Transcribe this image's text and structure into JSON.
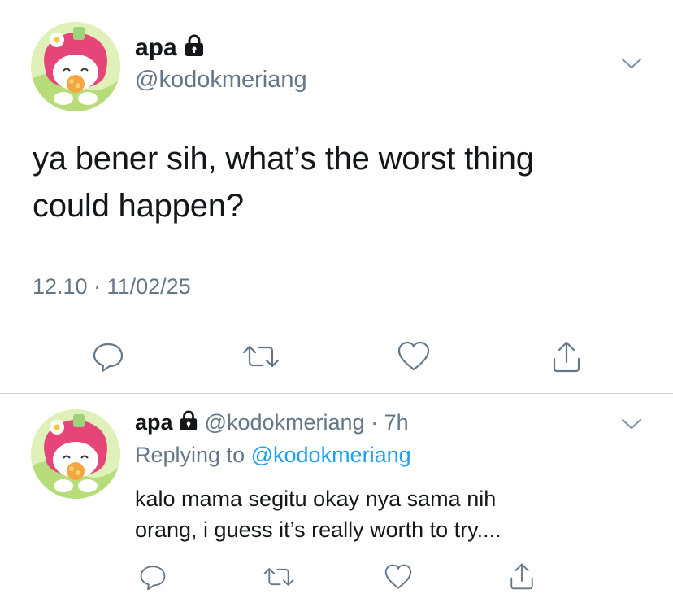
{
  "main_tweet": {
    "author_name": "apa",
    "author_handle": "@kodokmeriang",
    "text_line1": "ya bener sih, what’s the worst thing",
    "text_line2": "could happen?",
    "timestamp": "12.10 · 11/02/25"
  },
  "reply_tweet": {
    "author_name": "apa",
    "author_handle": "@kodokmeriang",
    "time_sep": "·",
    "time_ago": "7h",
    "replying_prefix": "Replying to",
    "replying_to": "@kodokmeriang",
    "text_line1": "kalo mama segitu okay nya sama nih",
    "text_line2": "orang, i guess it’s really worth to try...."
  },
  "icons": {
    "lock": "lock-icon",
    "caret": "chevron-down-icon",
    "reply": "reply-icon",
    "retweet": "retweet-icon",
    "like": "heart-icon",
    "share": "share-icon"
  },
  "colors": {
    "link": "#1da1f2",
    "secondary_text": "#657786",
    "avatar_pink": "#e6457a"
  }
}
